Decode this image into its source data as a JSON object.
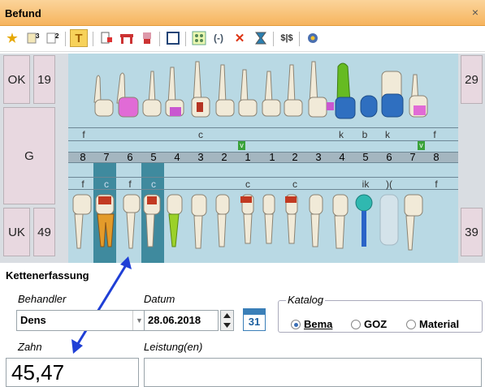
{
  "window": {
    "title": "Befund",
    "close_glyph": "×"
  },
  "chart": {
    "left_buttons": [
      "OK",
      "19",
      "G",
      "UK",
      "49"
    ],
    "right_buttons": [
      "29",
      "39"
    ],
    "upper_codes": [
      "f",
      "",
      "",
      "",
      "",
      "",
      "c",
      "",
      "",
      "",
      "",
      "",
      "k",
      "b",
      "k",
      "",
      "f"
    ],
    "upper_markers": [
      "v",
      "v"
    ],
    "tooth_numbers": [
      "8",
      "7",
      "6",
      "5",
      "4",
      "3",
      "2",
      "1",
      "1",
      "2",
      "3",
      "4",
      "5",
      "6",
      "7",
      "8"
    ],
    "lower_codes": [
      "f",
      "c",
      "f",
      "c",
      "",
      "",
      "",
      "c",
      "",
      "c",
      "",
      "",
      "ik",
      ")(",
      "",
      "f"
    ]
  },
  "section": {
    "title": "Kettenerfassung"
  },
  "form": {
    "behandler_label": "Behandler",
    "behandler_value": "Dens",
    "datum_label": "Datum",
    "datum_value": "28.06.2018",
    "calendar_day": "31",
    "katalog_label": "Katalog",
    "katalog_options": [
      "Bema",
      "GOZ",
      "Material"
    ],
    "katalog_selected": "Bema",
    "zahn_label": "Zahn",
    "zahn_value": "45,47",
    "leistung_label": "Leistung(en)",
    "leistung_value": ""
  },
  "colors": {
    "titlebar": "#f6b45e",
    "highlight": "#3f8a9e",
    "arrow": "#1f3fd6",
    "grid": "#b9d9e4"
  }
}
